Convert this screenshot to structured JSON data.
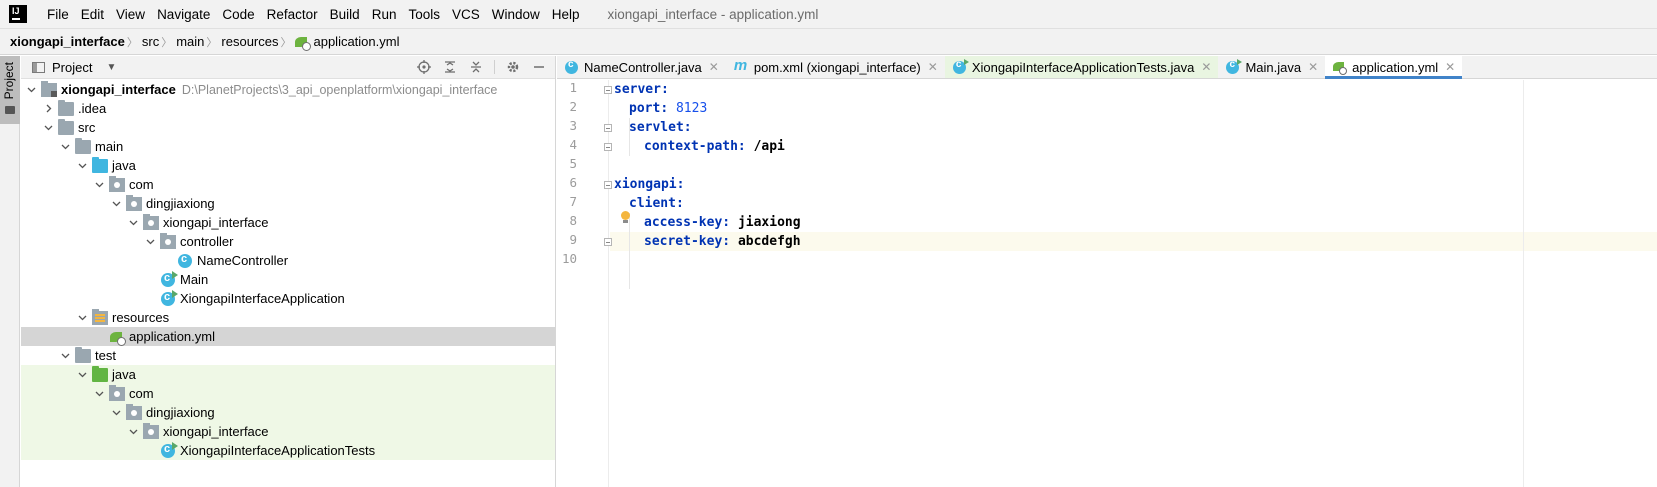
{
  "menubar": {
    "items": [
      "File",
      "Edit",
      "View",
      "Navigate",
      "Code",
      "Refactor",
      "Build",
      "Run",
      "Tools",
      "VCS",
      "Window",
      "Help"
    ],
    "window_title": "xiongapi_interface - application.yml"
  },
  "breadcrumb": {
    "items": [
      "xiongapi_interface",
      "src",
      "main",
      "resources",
      "application.yml"
    ]
  },
  "left_stripe": {
    "label": "Project"
  },
  "project_panel": {
    "title": "Project",
    "tree": [
      {
        "label": "xiongapi_interface",
        "hint": "D:\\PlanetProjects\\3_api_openplatform\\xiongapi_interface"
      },
      {
        "label": ".idea"
      },
      {
        "label": "src"
      },
      {
        "label": "main"
      },
      {
        "label": "java"
      },
      {
        "label": "com"
      },
      {
        "label": "dingjiaxiong"
      },
      {
        "label": "xiongapi_interface"
      },
      {
        "label": "controller"
      },
      {
        "label": "NameController"
      },
      {
        "label": "Main"
      },
      {
        "label": "XiongapiInterfaceApplication"
      },
      {
        "label": "resources"
      },
      {
        "label": "application.yml"
      },
      {
        "label": "test"
      },
      {
        "label": "java"
      },
      {
        "label": "com"
      },
      {
        "label": "dingjiaxiong"
      },
      {
        "label": "xiongapi_interface"
      },
      {
        "label": "XiongapiInterfaceApplicationTests"
      }
    ]
  },
  "editor": {
    "tabs": [
      {
        "label": "NameController.java",
        "icon": "java-class-icon"
      },
      {
        "label": "pom.xml (xiongapi_interface)",
        "icon": "maven-icon"
      },
      {
        "label": "XiongapiInterfaceApplicationTests.java",
        "icon": "java-runnable-class-icon"
      },
      {
        "label": "Main.java",
        "icon": "java-runnable-class-icon"
      },
      {
        "label": "application.yml",
        "icon": "spring-yaml-icon",
        "active": true
      }
    ],
    "close_glyph": "✕",
    "line_numbers": [
      "1",
      "2",
      "3",
      "4",
      "5",
      "6",
      "7",
      "8",
      "9",
      "10"
    ],
    "code": {
      "l1_key": "server",
      "l2_key": "port",
      "l2_val": "8123",
      "l3_key": "servlet",
      "l4_key": "context-path",
      "l4_val": "/api",
      "l6_key": "xiongapi",
      "l7_key": "client",
      "l8_key": "access-key",
      "l8_val": "jiaxiong",
      "l9_key": "secret-key",
      "l9_val": "abcdefgh",
      "colon": ":"
    }
  }
}
